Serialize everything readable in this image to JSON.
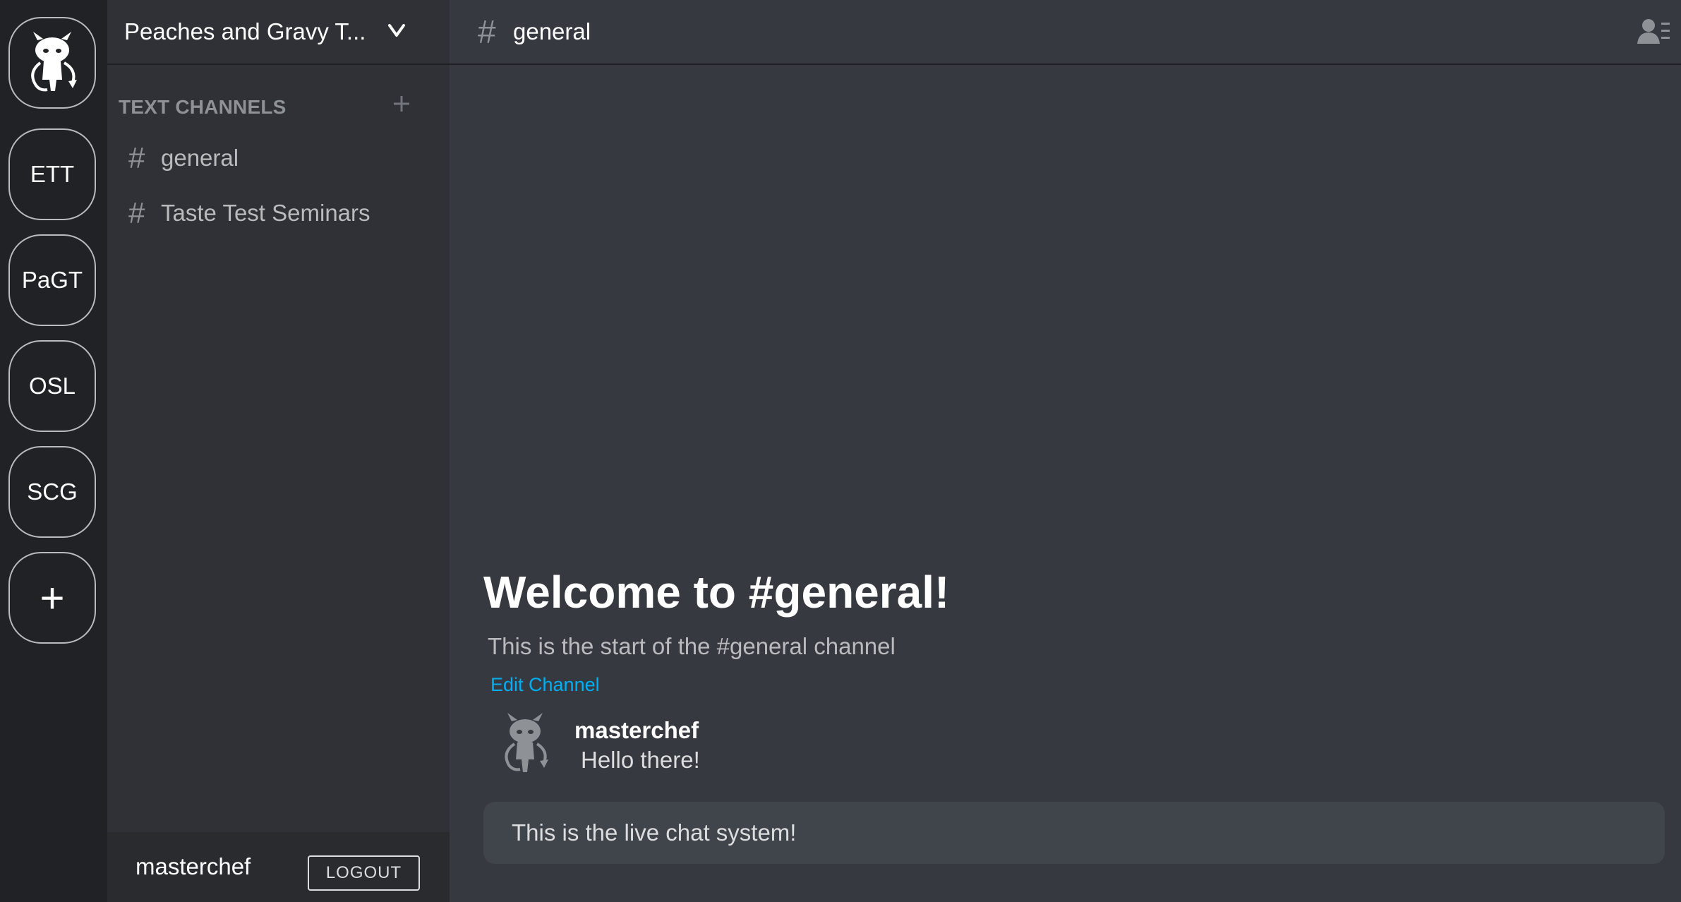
{
  "servers": [
    {
      "label": ""
    },
    {
      "label": "ETT"
    },
    {
      "label": "PaGT"
    },
    {
      "label": "OSL"
    },
    {
      "label": "SCG"
    },
    {
      "label": "+"
    }
  ],
  "server_header": {
    "name": "Peaches and Gravy T...",
    "icon": "chevron-down-icon"
  },
  "channels_section": {
    "title": "TEXT CHANNELS",
    "items": [
      {
        "label": "general",
        "icon": "hash"
      },
      {
        "label": "Taste Test Seminars",
        "icon": "hash"
      }
    ]
  },
  "user_bar": {
    "username": "masterchef",
    "logout_label": "LOGOUT"
  },
  "topbar": {
    "channel_name": "general",
    "hash_symbol": "#"
  },
  "welcome": {
    "title": "Welcome to #general!",
    "subtitle": "This is the start of the #general channel",
    "edit_link": "Edit Channel"
  },
  "messages": [
    {
      "author": "masterchef",
      "text": "Hello there!"
    }
  ],
  "composer": {
    "value": "This is the live chat system!"
  },
  "colors": {
    "rail_bg": "#202225",
    "sidebar_bg": "#2f3136",
    "main_bg": "#36393f",
    "composer_bg": "#40444b",
    "link": "#00aff4"
  }
}
